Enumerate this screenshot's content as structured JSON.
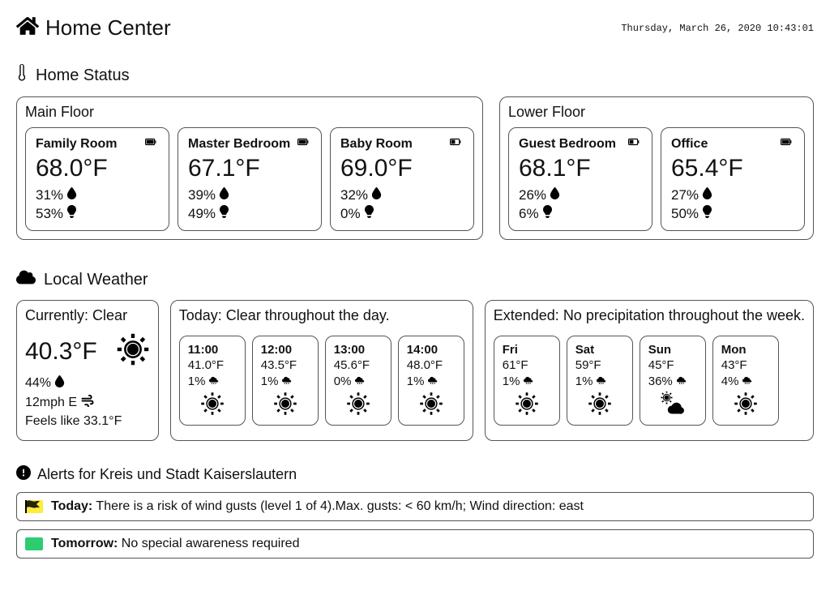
{
  "header": {
    "title": "Home Center",
    "datetime": "Thursday, March 26, 2020 10:43:01"
  },
  "homeStatus": {
    "title": "Home Status",
    "floors": [
      {
        "name": "Main Floor",
        "rooms": [
          {
            "name": "Family Room",
            "temp": "68.0°F",
            "humidity": "31%",
            "light": "53%",
            "battery": "full"
          },
          {
            "name": "Master Bedroom",
            "temp": "67.1°F",
            "humidity": "39%",
            "light": "49%",
            "battery": "full"
          },
          {
            "name": "Baby Room",
            "temp": "69.0°F",
            "humidity": "32%",
            "light": "0%",
            "battery": "half"
          }
        ]
      },
      {
        "name": "Lower Floor",
        "rooms": [
          {
            "name": "Guest Bedroom",
            "temp": "68.1°F",
            "humidity": "26%",
            "light": "6%",
            "battery": "half"
          },
          {
            "name": "Office",
            "temp": "65.4°F",
            "humidity": "27%",
            "light": "50%",
            "battery": "full"
          }
        ]
      }
    ]
  },
  "weather": {
    "title": "Local Weather",
    "current": {
      "label": "Currently:",
      "desc": "Clear",
      "temp": "40.3°F",
      "humidity": "44%",
      "wind": "12mph E",
      "feels": "Feels like 33.1°F"
    },
    "today": {
      "label": "Today:",
      "desc": "Clear throughout the day.",
      "hours": [
        {
          "time": "11:00",
          "temp": "41.0°F",
          "precip": "1%",
          "icon": "sun"
        },
        {
          "time": "12:00",
          "temp": "43.5°F",
          "precip": "1%",
          "icon": "sun"
        },
        {
          "time": "13:00",
          "temp": "45.6°F",
          "precip": "0%",
          "icon": "sun"
        },
        {
          "time": "14:00",
          "temp": "48.0°F",
          "precip": "1%",
          "icon": "sun"
        }
      ]
    },
    "extended": {
      "label": "Extended:",
      "desc": "No precipitation throughout the week.",
      "days": [
        {
          "day": "Fri",
          "temp": "61°F",
          "precip": "1%",
          "icon": "sun"
        },
        {
          "day": "Sat",
          "temp": "59°F",
          "precip": "1%",
          "icon": "sun"
        },
        {
          "day": "Sun",
          "temp": "45°F",
          "precip": "36%",
          "icon": "suncloud"
        },
        {
          "day": "Mon",
          "temp": "43°F",
          "precip": "4%",
          "icon": "sun"
        }
      ]
    }
  },
  "alerts": {
    "title": "Alerts for Kreis und Stadt Kaiserslautern",
    "items": [
      {
        "color": "yellow",
        "label": "Today:",
        "text": "There is a risk of wind gusts (level 1 of 4).Max. gusts: < 60 km/h; Wind direction: east"
      },
      {
        "color": "green",
        "label": "Tomorrow:",
        "text": "No special awareness required"
      }
    ]
  }
}
